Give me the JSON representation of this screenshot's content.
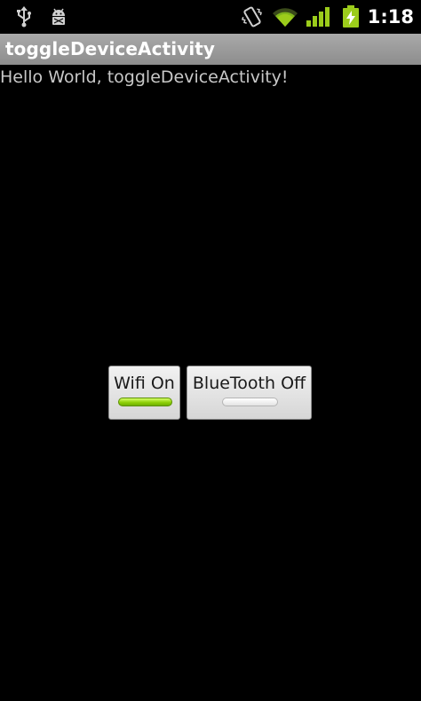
{
  "status_bar": {
    "icons": [
      "usb-icon",
      "android-debug-icon",
      "vibrate-icon",
      "wifi-signal-icon",
      "cell-signal-icon",
      "battery-charging-icon"
    ],
    "time": "1:18"
  },
  "app": {
    "title": "toggleDeviceActivity"
  },
  "main": {
    "hello_text": "Hello World, toggleDeviceActivity!",
    "buttons": [
      {
        "label": "Wifi On",
        "state": "on"
      },
      {
        "label": "BlueTooth Off",
        "state": "off"
      }
    ]
  },
  "colors": {
    "background": "#000000",
    "title_bar": "#9a9a9a",
    "indicator_on": "#8fd10a",
    "indicator_off": "#e3e3e3",
    "status_accent": "#9ccc1b"
  }
}
